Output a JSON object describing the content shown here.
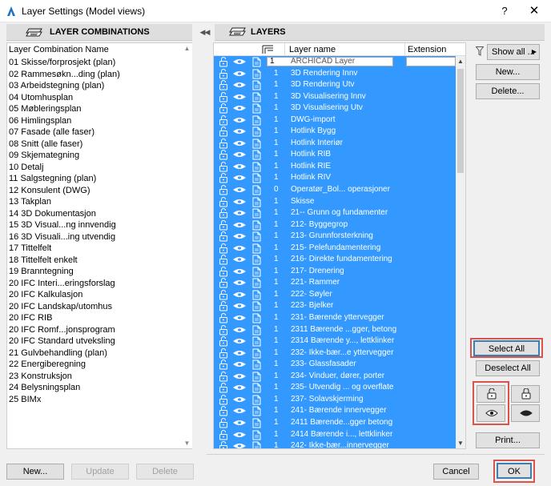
{
  "window": {
    "title": "Layer Settings (Model views)",
    "help": "?",
    "close": "✕"
  },
  "left_panel": {
    "header": "LAYER COMBINATIONS",
    "column_header": "Layer Combination Name",
    "items": [
      "01 Skisse/forprosjekt (plan)",
      "02 Rammesøkn...ding (plan)",
      "03 Arbeidstegning (plan)",
      "04 Utomhusplan",
      "05 Møbleringsplan",
      "06 Himlingsplan",
      "07 Fasade (alle faser)",
      "08 Snitt (alle faser)",
      "09 Skjemategning",
      "10 Detalj",
      "11 Salgstegning (plan)",
      "12 Konsulent (DWG)",
      "13 Takplan",
      "14 3D Dokumentasjon",
      "15 3D Visual...ng innvendig",
      "16 3D Visuali...ing utvendig",
      "17 Tittelfelt",
      "18 Tittelfelt enkelt",
      "19 Branntegning",
      "20 IFC Interi...eringsforslag",
      "20 IFC Kalkulasjon",
      "20 IFC Landskap/utomhus",
      "20 IFC RIB",
      "20 IFC Romf...jonsprogram",
      "20 IFC Standard utveksling",
      "21 Gulvbehandling (plan)",
      "22 Energiberegning",
      "23 Konstruksjon",
      "24 Belysningsplan",
      "25 BIMx"
    ],
    "buttons": {
      "new": "New...",
      "update": "Update",
      "delete": "Delete"
    }
  },
  "right_panel": {
    "header": "LAYERS",
    "columns": {
      "name": "Layer name",
      "extension": "Extension"
    },
    "layers": [
      {
        "num": "1",
        "name": "ARCHICAD Layer"
      },
      {
        "num": "1",
        "name": "3D Rendering Innv"
      },
      {
        "num": "1",
        "name": "3D Rendering Utv"
      },
      {
        "num": "1",
        "name": "3D Visualisering Innv"
      },
      {
        "num": "1",
        "name": "3D Visualisering Utv"
      },
      {
        "num": "1",
        "name": "DWG-import"
      },
      {
        "num": "1",
        "name": "Hotlink Bygg"
      },
      {
        "num": "1",
        "name": "Hotlink Interiør"
      },
      {
        "num": "1",
        "name": "Hotlink RIB"
      },
      {
        "num": "1",
        "name": "Hotlink RIE"
      },
      {
        "num": "1",
        "name": "Hotlink RIV"
      },
      {
        "num": "0",
        "name": "Operatør_Bol... operasjoner"
      },
      {
        "num": "1",
        "name": "Skisse"
      },
      {
        "num": "1",
        "name": "21-- Grunn og fundamenter"
      },
      {
        "num": "1",
        "name": "212- Byggegrop"
      },
      {
        "num": "1",
        "name": "213- Grunnforsterkning"
      },
      {
        "num": "1",
        "name": "215- Pelefundamentering"
      },
      {
        "num": "1",
        "name": "216- Direkte fundamentering"
      },
      {
        "num": "1",
        "name": "217- Drenering"
      },
      {
        "num": "1",
        "name": "221- Rammer"
      },
      {
        "num": "1",
        "name": "222- Søyler"
      },
      {
        "num": "1",
        "name": "223- Bjelker"
      },
      {
        "num": "1",
        "name": "231- Bærende yttervegger"
      },
      {
        "num": "1",
        "name": "2311 Bærende ...gger, betong"
      },
      {
        "num": "1",
        "name": "2314 Bærende y..., lettklinker"
      },
      {
        "num": "1",
        "name": "232- Ikke-bær...e yttervegger"
      },
      {
        "num": "1",
        "name": "233- Glassfasader"
      },
      {
        "num": "1",
        "name": "234- Vinduer, dører, porter"
      },
      {
        "num": "1",
        "name": "235- Utvendig ... og overflate"
      },
      {
        "num": "1",
        "name": "237- Solavskjerming"
      },
      {
        "num": "1",
        "name": "241- Bærende innervegger"
      },
      {
        "num": "1",
        "name": "2411 Bærende...gger betong"
      },
      {
        "num": "1",
        "name": "2414 Bærende i..., lettklinker"
      },
      {
        "num": "1",
        "name": "242- Ikke-bær...innervegger"
      }
    ],
    "buttons": {
      "show_all": "Show all ...",
      "new": "New...",
      "delete": "Delete...",
      "select_all": "Select All",
      "deselect_all": "Deselect All",
      "print": "Print..."
    }
  },
  "footer": {
    "cancel": "Cancel",
    "ok": "OK"
  },
  "colors": {
    "selection": "#3399ff",
    "highlight": "#d9534f"
  }
}
